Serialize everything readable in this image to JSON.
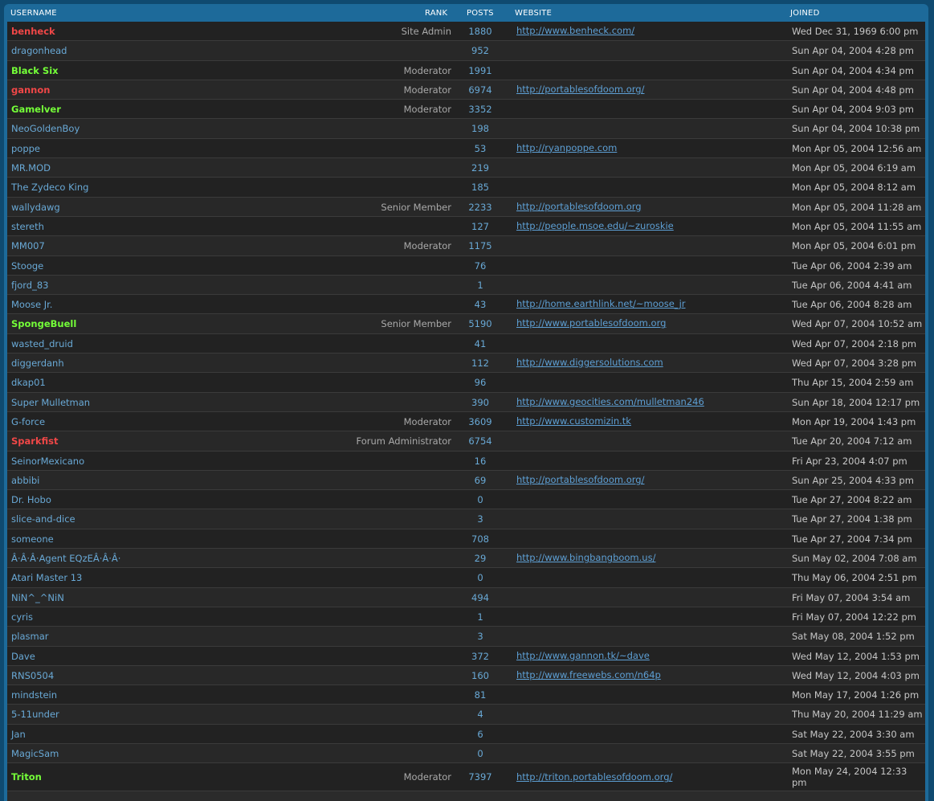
{
  "headers": {
    "username": "USERNAME",
    "rank": "RANK",
    "posts": "POSTS",
    "website": "WEBSITE",
    "joined": "JOINED"
  },
  "members": [
    {
      "username": "benheck",
      "role": "admin",
      "rank": "Site Admin",
      "posts": "1880",
      "website": "http://www.benheck.com/",
      "joined": "Wed Dec 31, 1969 6:00 pm"
    },
    {
      "username": "dragonhead",
      "role": "user",
      "rank": "",
      "posts": "952",
      "website": "",
      "joined": "Sun Apr 04, 2004 4:28 pm"
    },
    {
      "username": "Black Six",
      "role": "mod",
      "rank": "Moderator",
      "posts": "1991",
      "website": "",
      "joined": "Sun Apr 04, 2004 4:34 pm"
    },
    {
      "username": "gannon",
      "role": "admin",
      "rank": "Moderator",
      "posts": "6974",
      "website": "http://portablesofdoom.org/",
      "joined": "Sun Apr 04, 2004 4:48 pm"
    },
    {
      "username": "Gamelver",
      "role": "mod",
      "rank": "Moderator",
      "posts": "3352",
      "website": "",
      "joined": "Sun Apr 04, 2004 9:03 pm"
    },
    {
      "username": "NeoGoldenBoy",
      "role": "user",
      "rank": "",
      "posts": "198",
      "website": "",
      "joined": "Sun Apr 04, 2004 10:38 pm"
    },
    {
      "username": "poppe",
      "role": "user",
      "rank": "",
      "posts": "53",
      "website": "http://ryanpoppe.com",
      "joined": "Mon Apr 05, 2004 12:56 am"
    },
    {
      "username": "MR.MOD",
      "role": "user",
      "rank": "",
      "posts": "219",
      "website": "",
      "joined": "Mon Apr 05, 2004 6:19 am"
    },
    {
      "username": "The Zydeco King",
      "role": "user",
      "rank": "",
      "posts": "185",
      "website": "",
      "joined": "Mon Apr 05, 2004 8:12 am"
    },
    {
      "username": "wallydawg",
      "role": "user",
      "rank": "Senior Member",
      "posts": "2233",
      "website": "http://portablesofdoom.org",
      "joined": "Mon Apr 05, 2004 11:28 am"
    },
    {
      "username": "stereth",
      "role": "user",
      "rank": "",
      "posts": "127",
      "website": "http://people.msoe.edu/~zuroskie",
      "joined": "Mon Apr 05, 2004 11:55 am"
    },
    {
      "username": "MM007",
      "role": "user",
      "rank": "Moderator",
      "posts": "1175",
      "website": "",
      "joined": "Mon Apr 05, 2004 6:01 pm"
    },
    {
      "username": "Stooge",
      "role": "user",
      "rank": "",
      "posts": "76",
      "website": "",
      "joined": "Tue Apr 06, 2004 2:39 am"
    },
    {
      "username": "fjord_83",
      "role": "user",
      "rank": "",
      "posts": "1",
      "website": "",
      "joined": "Tue Apr 06, 2004 4:41 am"
    },
    {
      "username": "Moose Jr.",
      "role": "user",
      "rank": "",
      "posts": "43",
      "website": "http://home.earthlink.net/~moose_jr",
      "joined": "Tue Apr 06, 2004 8:28 am"
    },
    {
      "username": "SpongeBuell",
      "role": "mod",
      "rank": "Senior Member",
      "posts": "5190",
      "website": "http://www.portablesofdoom.org",
      "joined": "Wed Apr 07, 2004 10:52 am"
    },
    {
      "username": "wasted_druid",
      "role": "user",
      "rank": "",
      "posts": "41",
      "website": "",
      "joined": "Wed Apr 07, 2004 2:18 pm"
    },
    {
      "username": "diggerdanh",
      "role": "user",
      "rank": "",
      "posts": "112",
      "website": "http://www.diggersolutions.com",
      "joined": "Wed Apr 07, 2004 3:28 pm"
    },
    {
      "username": "dkap01",
      "role": "user",
      "rank": "",
      "posts": "96",
      "website": "",
      "joined": "Thu Apr 15, 2004 2:59 am"
    },
    {
      "username": "Super Mulletman",
      "role": "user",
      "rank": "",
      "posts": "390",
      "website": "http://www.geocities.com/mulletman246",
      "joined": "Sun Apr 18, 2004 12:17 pm"
    },
    {
      "username": "G-force",
      "role": "user",
      "rank": "Moderator",
      "posts": "3609",
      "website": "http://www.customizin.tk",
      "joined": "Mon Apr 19, 2004 1:43 pm"
    },
    {
      "username": "Sparkfist",
      "role": "admin",
      "rank": "Forum Administrator",
      "posts": "6754",
      "website": "",
      "joined": "Tue Apr 20, 2004 7:12 am"
    },
    {
      "username": "SeinorMexicano",
      "role": "user",
      "rank": "",
      "posts": "16",
      "website": "",
      "joined": "Fri Apr 23, 2004 4:07 pm"
    },
    {
      "username": "abbibi",
      "role": "user",
      "rank": "",
      "posts": "69",
      "website": "http://portablesofdoom.org/",
      "joined": "Sun Apr 25, 2004 4:33 pm"
    },
    {
      "username": "Dr. Hobo",
      "role": "user",
      "rank": "",
      "posts": "0",
      "website": "",
      "joined": "Tue Apr 27, 2004 8:22 am"
    },
    {
      "username": "slice-and-dice",
      "role": "user",
      "rank": "",
      "posts": "3",
      "website": "",
      "joined": "Tue Apr 27, 2004 1:38 pm"
    },
    {
      "username": "someone",
      "role": "user",
      "rank": "",
      "posts": "708",
      "website": "",
      "joined": "Tue Apr 27, 2004 7:34 pm"
    },
    {
      "username": "Â·Â·Â·Agent EQzEÂ·Â·Â·",
      "role": "user",
      "rank": "",
      "posts": "29",
      "website": "http://www.bingbangboom.us/",
      "joined": "Sun May 02, 2004 7:08 am"
    },
    {
      "username": "Atari Master 13",
      "role": "user",
      "rank": "",
      "posts": "0",
      "website": "",
      "joined": "Thu May 06, 2004 2:51 pm"
    },
    {
      "username": "NiN^_^NiN",
      "role": "user",
      "rank": "",
      "posts": "494",
      "website": "",
      "joined": "Fri May 07, 2004 3:54 am"
    },
    {
      "username": "cyris",
      "role": "user",
      "rank": "",
      "posts": "1",
      "website": "",
      "joined": "Fri May 07, 2004 12:22 pm"
    },
    {
      "username": "plasmar",
      "role": "user",
      "rank": "",
      "posts": "3",
      "website": "",
      "joined": "Sat May 08, 2004 1:52 pm"
    },
    {
      "username": "Dave",
      "role": "user",
      "rank": "",
      "posts": "372",
      "website": "http://www.gannon.tk/~dave",
      "joined": "Wed May 12, 2004 1:53 pm"
    },
    {
      "username": "RNS0504",
      "role": "user",
      "rank": "",
      "posts": "160",
      "website": "http://www.freewebs.com/n64p",
      "joined": "Wed May 12, 2004 4:03 pm"
    },
    {
      "username": "mindstein",
      "role": "user",
      "rank": "",
      "posts": "81",
      "website": "",
      "joined": "Mon May 17, 2004 1:26 pm"
    },
    {
      "username": "5-11under",
      "role": "user",
      "rank": "",
      "posts": "4",
      "website": "",
      "joined": "Thu May 20, 2004 11:29 am"
    },
    {
      "username": "Jan",
      "role": "user",
      "rank": "",
      "posts": "6",
      "website": "",
      "joined": "Sat May 22, 2004 3:30 am"
    },
    {
      "username": "MagicSam",
      "role": "user",
      "rank": "",
      "posts": "0",
      "website": "",
      "joined": "Sat May 22, 2004 3:55 pm"
    },
    {
      "username": "Triton",
      "role": "mod",
      "rank": "Moderator",
      "posts": "7397",
      "website": "http://triton.portablesofdoom.org/",
      "joined": "Mon May 24, 2004 12:33 pm"
    }
  ]
}
